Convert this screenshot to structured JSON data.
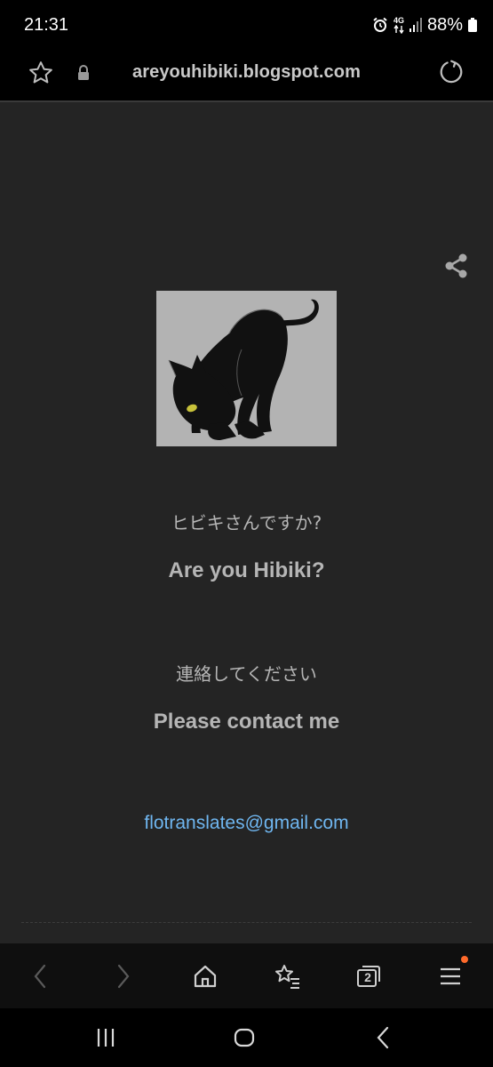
{
  "status_bar": {
    "time": "21:31",
    "network": "4G",
    "battery": "88%"
  },
  "address_bar": {
    "url": "areyouhibiki.blogspot.com"
  },
  "content": {
    "question_jp": "ヒビキさんですか?",
    "question_en": "Are you Hibiki?",
    "contact_jp": "連絡してください",
    "contact_en": "Please contact me",
    "email": "flotranslates@gmail.com"
  },
  "toolbar": {
    "tab_count": "2"
  },
  "colors": {
    "page_background": "#242424",
    "text": "#b5b5b5",
    "link": "#6fb6f0",
    "notification_dot": "#ff6a2b"
  },
  "icons": [
    "star-icon",
    "lock-icon",
    "reload-icon",
    "share-icon",
    "back-arrow-icon",
    "forward-arrow-icon",
    "home-icon",
    "bookmarks-icon",
    "tabs-icon",
    "menu-icon",
    "recents-icon",
    "nav-home-icon",
    "nav-back-icon"
  ]
}
